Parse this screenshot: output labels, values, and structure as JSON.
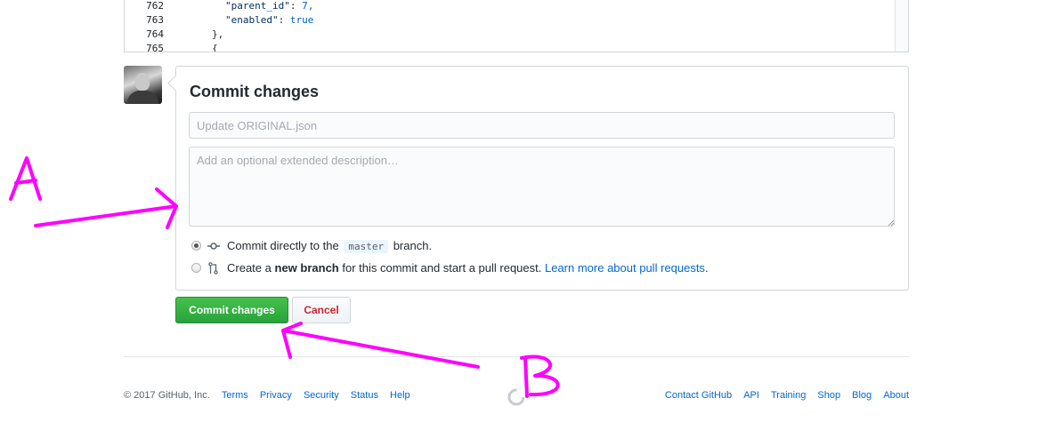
{
  "code": {
    "lines": [
      {
        "num": "762",
        "key": "\"parent_id\"",
        "sep": ": ",
        "val": "7,"
      },
      {
        "num": "763",
        "key": "\"enabled\"",
        "sep": ": ",
        "val": "true"
      },
      {
        "num": "764",
        "text": "},"
      },
      {
        "num": "765",
        "text": "{"
      }
    ]
  },
  "commit_form": {
    "title": "Commit changes",
    "summary_placeholder": "Update ORIGINAL.json",
    "description_placeholder": "Add an optional extended description…",
    "option_direct": {
      "prefix": "Commit directly to the",
      "branch": "master",
      "suffix": "branch.",
      "selected": true,
      "icon": "git-commit-icon"
    },
    "option_new_branch": {
      "prefix": "Create a",
      "bold": "new branch",
      "middle": "for this commit and start a pull request.",
      "link": "Learn more about pull requests",
      "end": ".",
      "selected": false,
      "icon": "git-pull-request-icon"
    }
  },
  "buttons": {
    "commit": "Commit changes",
    "cancel": "Cancel"
  },
  "footer": {
    "copyright": "© 2017 GitHub, Inc.",
    "left_links": [
      "Terms",
      "Privacy",
      "Security",
      "Status",
      "Help"
    ],
    "right_links": [
      "Contact GitHub",
      "API",
      "Training",
      "Shop",
      "Blog",
      "About"
    ]
  },
  "annotations": {
    "label_a": "A",
    "label_b": "B",
    "color": "#ff00ff"
  }
}
